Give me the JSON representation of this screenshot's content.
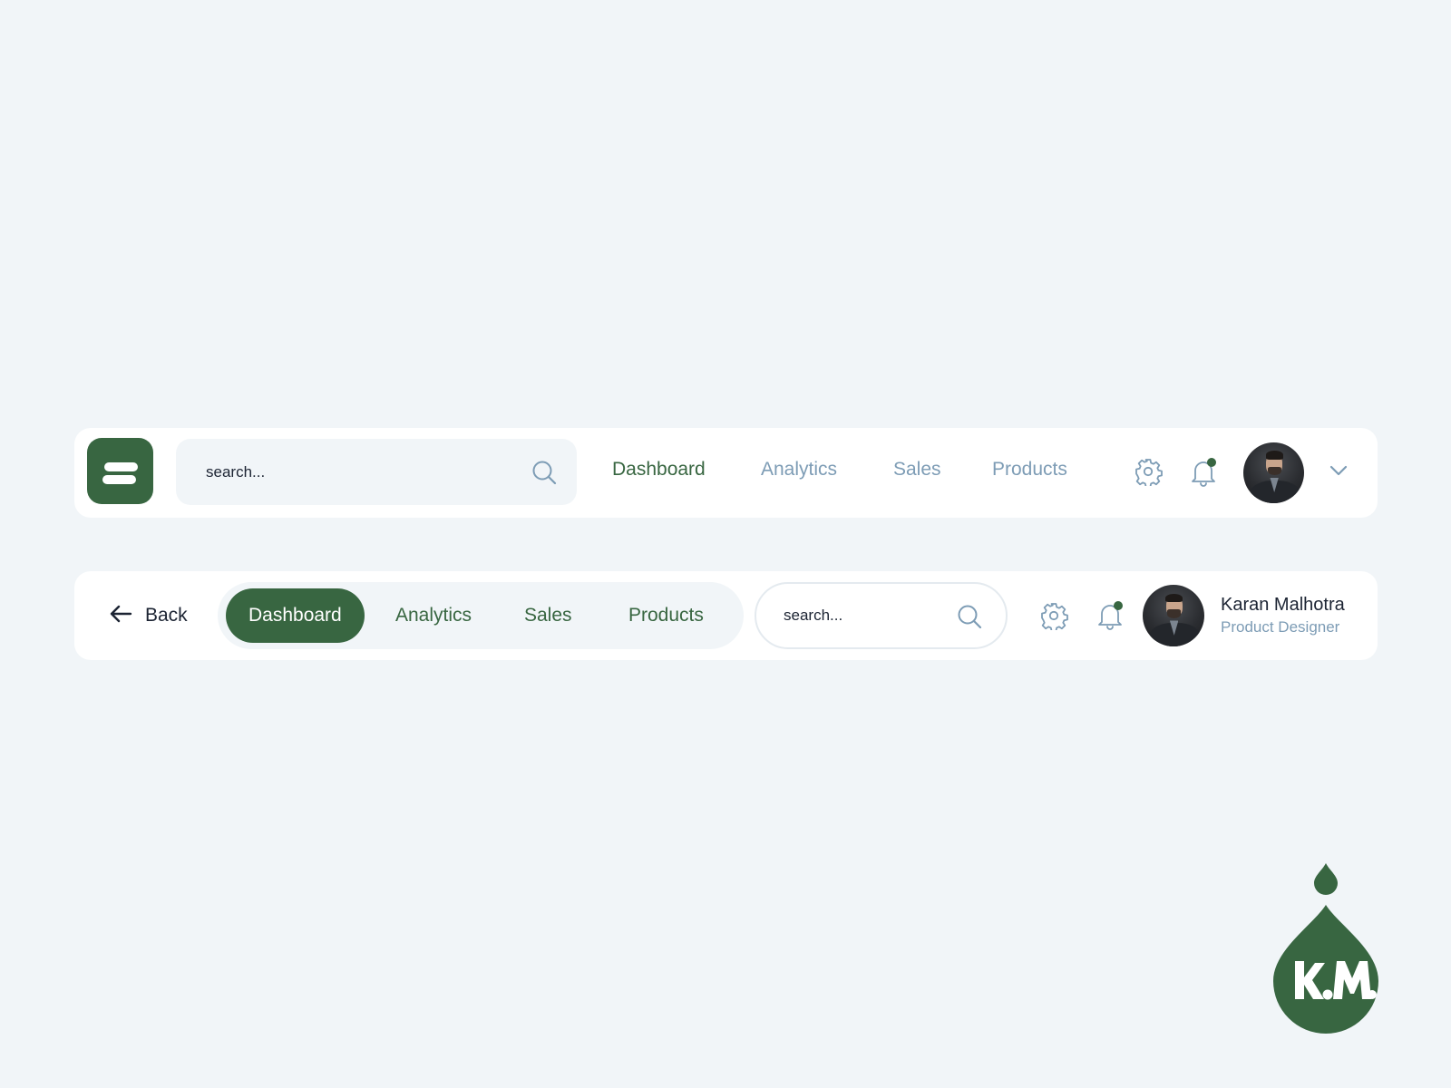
{
  "navbar_v1": {
    "search": {
      "placeholder": "search..."
    },
    "nav": [
      "Dashboard",
      "Analytics",
      "Sales",
      "Products"
    ],
    "active_index": 0,
    "icons": [
      "menu-icon",
      "search-icon",
      "gear-icon",
      "bell-icon",
      "chevron-down-icon"
    ],
    "has_notification": true
  },
  "navbar_v2": {
    "back_label": "Back",
    "tabs": [
      "Dashboard",
      "Analytics",
      "Sales",
      "Products"
    ],
    "active_index": 0,
    "search": {
      "placeholder": "search..."
    },
    "user": {
      "name": "Karan Malhotra",
      "role": "Product Designer"
    },
    "icons": [
      "arrow-left-icon",
      "search-icon",
      "gear-icon",
      "bell-icon"
    ],
    "has_notification": true
  },
  "brand": {
    "logo_text": "k.M."
  },
  "colors": {
    "background": "#f1f5f8",
    "surface": "#ffffff",
    "accent": "#386641",
    "muted": "#7d9cb5",
    "text": "#1c2433"
  }
}
